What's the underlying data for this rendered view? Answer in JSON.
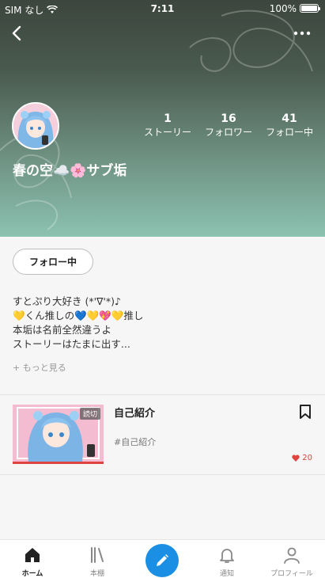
{
  "status_bar": {
    "carrier": "SIM なし",
    "time": "7:11",
    "battery": "100%"
  },
  "profile": {
    "display_name": "春の空☁️🌸サブ垢",
    "stats": [
      {
        "value": "1",
        "label": "ストーリー"
      },
      {
        "value": "16",
        "label": "フォロワー"
      },
      {
        "value": "41",
        "label": "フォロー中"
      }
    ],
    "follow_button": "フォロー中",
    "bio_lines": [
      "すとぷり大好き (*'∇'*)♪",
      "💛くん推しの💙💛💖💛推し",
      "本垢は名前全然違うよ",
      "ストーリーはたまに出す..."
    ],
    "more_link": "+ もっと見る"
  },
  "stories": [
    {
      "title": "自己紹介",
      "tag": "#自己紹介",
      "badge": "読切",
      "likes": "20"
    }
  ],
  "tabbar": {
    "items": [
      {
        "label": "ホーム",
        "icon": "home-icon"
      },
      {
        "label": "本棚",
        "icon": "bookshelf-icon"
      },
      {
        "label": "",
        "icon": "pencil-icon"
      },
      {
        "label": "通知",
        "icon": "bell-icon"
      },
      {
        "label": "プロフィール",
        "icon": "person-icon"
      }
    ]
  },
  "colors": {
    "accent": "#1a8fe3",
    "like": "#e0443e"
  }
}
